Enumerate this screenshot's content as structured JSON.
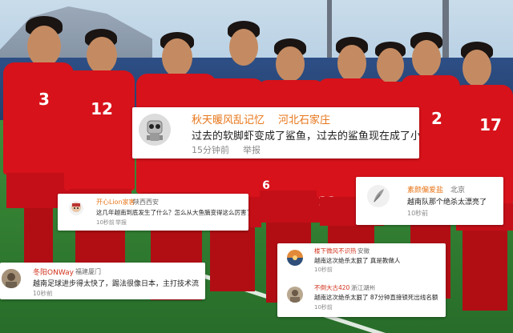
{
  "colors": {
    "username_orange": "#e8761a",
    "username_red": "#d2321c",
    "jersey_red": "#d7121a",
    "card_bg": "#ffffff",
    "meta_gray": "#8a8a8a"
  },
  "players": {
    "numbers": [
      "3",
      "12",
      "2",
      "17",
      "6",
      "11"
    ]
  },
  "comments": [
    {
      "username": "秋天暖风乱记忆",
      "location": "河北石家庄",
      "text": "过去的软脚虾变成了鲨鱼，过去的鲨鱼现在成了小鱼",
      "time": "15分钟前",
      "action": "举报",
      "avatar_icon": "robot-avatar-icon"
    },
    {
      "username": "开心Lion家客",
      "location": "陕西西安",
      "text": "这几年越南到底发生了什么？怎么从大鱼腩变得这么厉害了",
      "time": "10秒前",
      "action": "举报",
      "avatar_icon": "cartoon-avatar-icon"
    },
    {
      "username": "素颜偏爱盐",
      "location": "北京",
      "text": "越南队那个绝杀太漂亮了",
      "time": "10秒前",
      "avatar_icon": "feather-avatar-icon"
    },
    {
      "username": "冬阳ONWay",
      "location": "福建厦门",
      "text": "越南足球进步得太快了，踢法很像日本，主打技术流",
      "time": "10秒前",
      "avatar_icon": "photo-avatar-icon"
    },
    {
      "username": "楼下微风不识热",
      "location": "安徽",
      "text": "越南这次绝杀太狠了 真是教做人",
      "time": "10秒前",
      "avatar_icon": "sunset-avatar-icon"
    },
    {
      "username": "不倒大古420",
      "location": "浙江湖州",
      "text": "越南这次绝杀太狠了 87分钟直接锁死出线名额",
      "time": "10秒前",
      "avatar_icon": "photo-avatar-icon"
    }
  ]
}
